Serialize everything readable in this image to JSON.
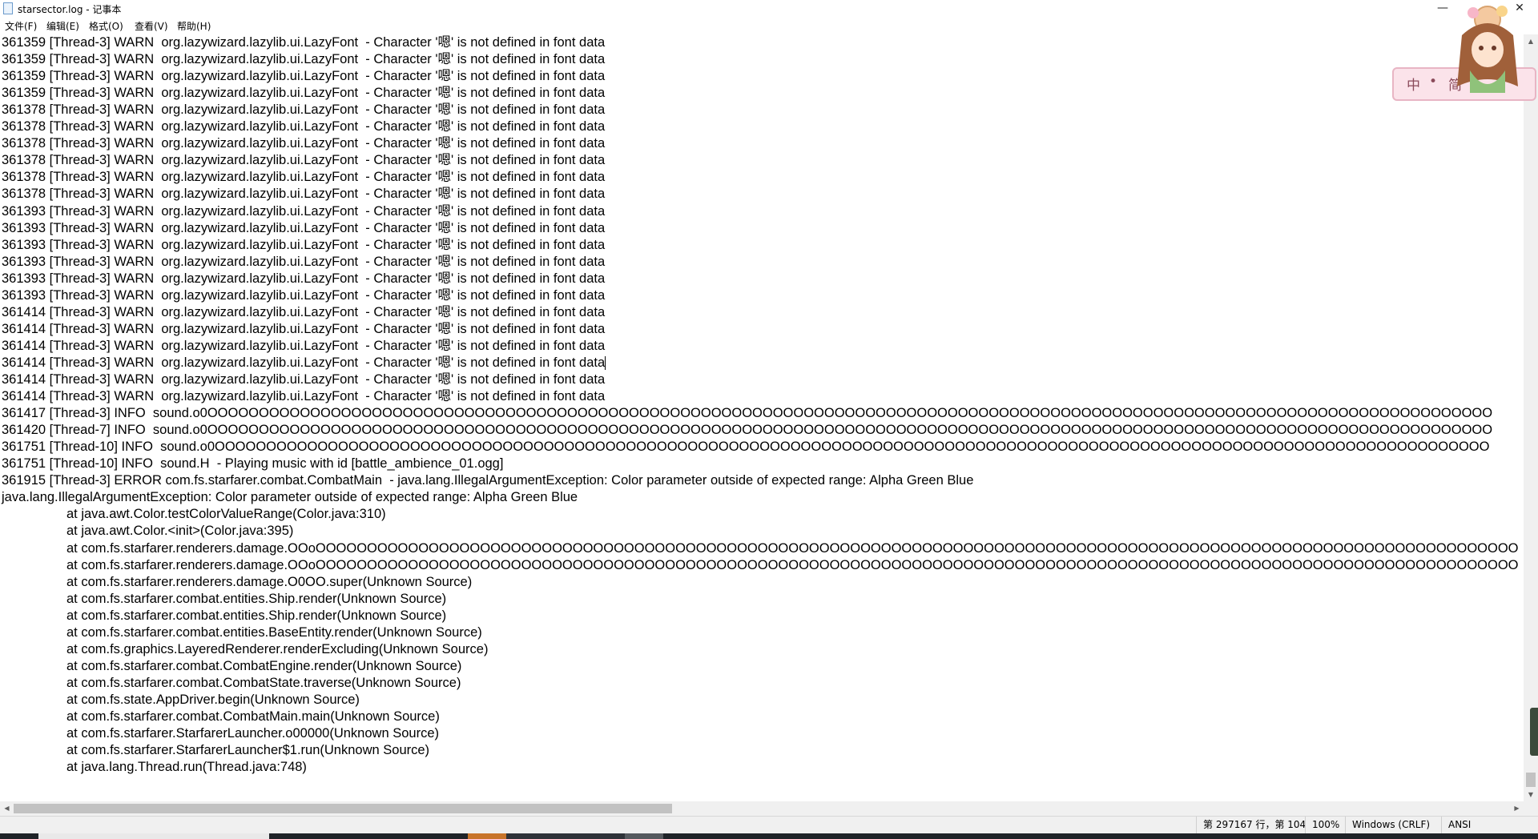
{
  "window": {
    "title": "starsector.log - 记事本",
    "minimize_glyph": "—",
    "close_glyph": "✕"
  },
  "menu": [
    "文件(F)",
    "编辑(E)",
    "格式(O)",
    "查看(V)",
    "帮助(H)"
  ],
  "log_lines": [
    "361359 [Thread-3] WARN  org.lazywizard.lazylib.ui.LazyFont  - Character '嗯' is not defined in font data",
    "361359 [Thread-3] WARN  org.lazywizard.lazylib.ui.LazyFont  - Character '嗯' is not defined in font data",
    "361359 [Thread-3] WARN  org.lazywizard.lazylib.ui.LazyFont  - Character '嗯' is not defined in font data",
    "361359 [Thread-3] WARN  org.lazywizard.lazylib.ui.LazyFont  - Character '嗯' is not defined in font data",
    "361378 [Thread-3] WARN  org.lazywizard.lazylib.ui.LazyFont  - Character '嗯' is not defined in font data",
    "361378 [Thread-3] WARN  org.lazywizard.lazylib.ui.LazyFont  - Character '嗯' is not defined in font data",
    "361378 [Thread-3] WARN  org.lazywizard.lazylib.ui.LazyFont  - Character '嗯' is not defined in font data",
    "361378 [Thread-3] WARN  org.lazywizard.lazylib.ui.LazyFont  - Character '嗯' is not defined in font data",
    "361378 [Thread-3] WARN  org.lazywizard.lazylib.ui.LazyFont  - Character '嗯' is not defined in font data",
    "361378 [Thread-3] WARN  org.lazywizard.lazylib.ui.LazyFont  - Character '嗯' is not defined in font data",
    "361393 [Thread-3] WARN  org.lazywizard.lazylib.ui.LazyFont  - Character '嗯' is not defined in font data",
    "361393 [Thread-3] WARN  org.lazywizard.lazylib.ui.LazyFont  - Character '嗯' is not defined in font data",
    "361393 [Thread-3] WARN  org.lazywizard.lazylib.ui.LazyFont  - Character '嗯' is not defined in font data",
    "361393 [Thread-3] WARN  org.lazywizard.lazylib.ui.LazyFont  - Character '嗯' is not defined in font data",
    "361393 [Thread-3] WARN  org.lazywizard.lazylib.ui.LazyFont  - Character '嗯' is not defined in font data",
    "361393 [Thread-3] WARN  org.lazywizard.lazylib.ui.LazyFont  - Character '嗯' is not defined in font data",
    "361414 [Thread-3] WARN  org.lazywizard.lazylib.ui.LazyFont  - Character '嗯' is not defined in font data",
    "361414 [Thread-3] WARN  org.lazywizard.lazylib.ui.LazyFont  - Character '嗯' is not defined in font data",
    "361414 [Thread-3] WARN  org.lazywizard.lazylib.ui.LazyFont  - Character '嗯' is not defined in font data",
    "361414 [Thread-3] WARN  org.lazywizard.lazylib.ui.LazyFont  - Character '嗯' is not defined in font data",
    "361414 [Thread-3] WARN  org.lazywizard.lazylib.ui.LazyFont  - Character '嗯' is not defined in font data",
    "361414 [Thread-3] WARN  org.lazywizard.lazylib.ui.LazyFont  - Character '嗯' is not defined in font data",
    "361417 [Thread-3] INFO  sound.o0OOOOOOOOOOOOOOOOOOOOOOOOOOOOOOOOOOOOOOOOOOOOOOOOOOOOOOOOOOOOOOOOOOOOOOOOOOOOOOOOOOOOOOOOOOOOOOOOOOOOOOOOOOOOOOOOOOOOOOOOOOOOO",
    "361420 [Thread-7] INFO  sound.o0OOOOOOOOOOOOOOOOOOOOOOOOOOOOOOOOOOOOOOOOOOOOOOOOOOOOOOOOOOOOOOOOOOOOOOOOOOOOOOOOOOOOOOOOOOOOOOOOOOOOOOOOOOOOOOOOOOOOOOOOOOOOO",
    "361751 [Thread-10] INFO  sound.o0OOOOOOOOOOOOOOOOOOOOOOOOOOOOOOOOOOOOOOOOOOOOOOOOOOOOOOOOOOOOOOOOOOOOOOOOOOOOOOOOOOOOOOOOOOOOOOOOOOOOOOOOOOOOOOOOOOOOOOOOOOOO",
    "361751 [Thread-10] INFO  sound.H  - Playing music with id [battle_ambience_01.ogg]",
    "361915 [Thread-3] ERROR com.fs.starfarer.combat.CombatMain  - java.lang.IllegalArgumentException: Color parameter outside of expected range: Alpha Green Blue",
    "java.lang.IllegalArgumentException: Color parameter outside of expected range: Alpha Green Blue",
    "\tat java.awt.Color.testColorValueRange(Color.java:310)",
    "\tat java.awt.Color.<init>(Color.java:395)",
    "\tat com.fs.starfarer.renderers.damage.OOoOOOOOOOOOOOOOOOOOOOOOOOOOOOOOOOOOOOOOOOOOOOOOOOOOOOOOOOOOOOOOOOOOOOOOOOOOOOOOOOOOOOOOOOOOOOOOOOOOOOOOOOOOOOOOOOOOOOOO",
    "\tat com.fs.starfarer.renderers.damage.OOoOOOOOOOOOOOOOOOOOOOOOOOOOOOOOOOOOOOOOOOOOOOOOOOOOOOOOOOOOOOOOOOOOOOOOOOOOOOOOOOOOOOOOOOOOOOOOOOOOOOOOOOOOOOOOOOOOOOOO",
    "\tat com.fs.starfarer.renderers.damage.O0OO.super(Unknown Source)",
    "\tat com.fs.starfarer.combat.entities.Ship.render(Unknown Source)",
    "\tat com.fs.starfarer.combat.entities.Ship.render(Unknown Source)",
    "\tat com.fs.starfarer.combat.entities.BaseEntity.render(Unknown Source)",
    "\tat com.fs.graphics.LayeredRenderer.renderExcluding(Unknown Source)",
    "\tat com.fs.starfarer.combat.CombatEngine.render(Unknown Source)",
    "\tat com.fs.starfarer.combat.CombatState.traverse(Unknown Source)",
    "\tat com.fs.state.AppDriver.begin(Unknown Source)",
    "\tat com.fs.starfarer.combat.CombatMain.main(Unknown Source)",
    "\tat com.fs.starfarer.StarfarerLauncher.o00000(Unknown Source)",
    "\tat com.fs.starfarer.StarfarerLauncher$1.run(Unknown Source)",
    "\tat java.lang.Thread.run(Thread.java:748)"
  ],
  "caret": {
    "line": 19
  },
  "status": {
    "position": "第 297167 行，第 104",
    "zoom": "100%",
    "line_ending": "Windows (CRLF)",
    "encoding": "ANSI"
  },
  "ime": {
    "label_zh": "中",
    "label_dots": "•",
    "label_mode": "简"
  },
  "scroll": {
    "horizontal_fraction": 0.44
  },
  "colors": {
    "text": "#000000",
    "background": "#ffffff",
    "status_bar": "#f0f0f0",
    "taskbar": "#1f2328",
    "taskbar_accent": "#c8742a"
  }
}
